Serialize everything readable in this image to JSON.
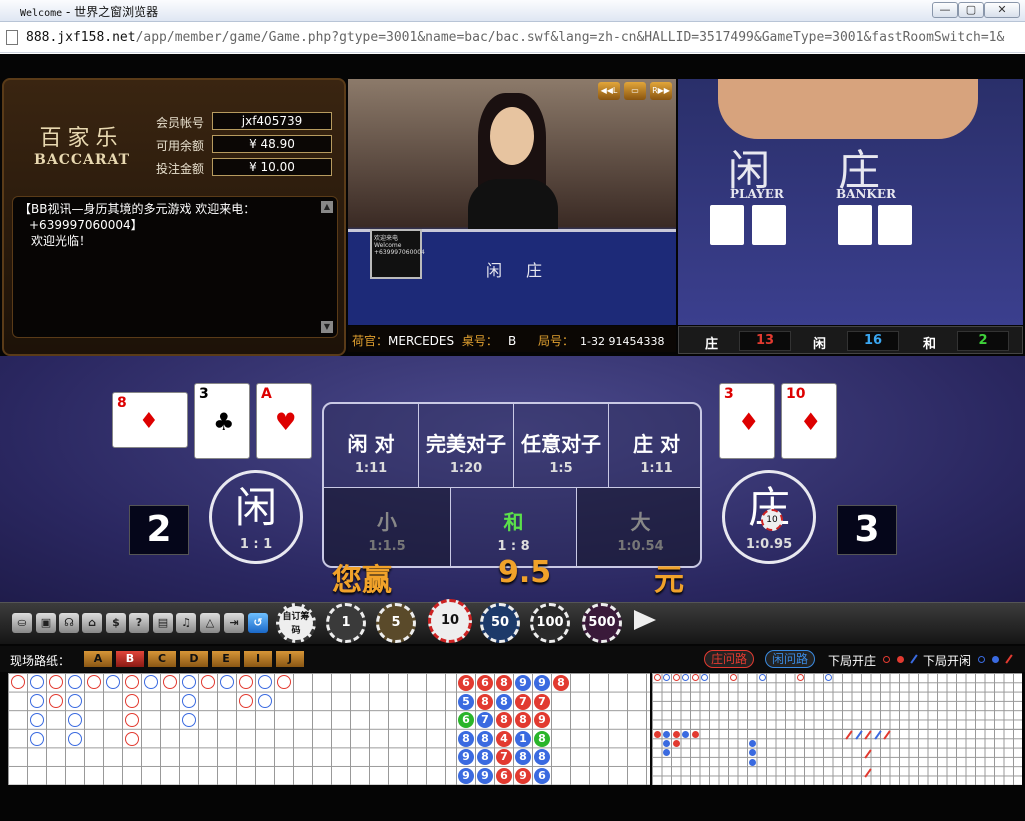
{
  "window": {
    "title_prefix": "Welcome",
    "title_rest": " - 世界之窗浏览器"
  },
  "address": {
    "host": "888.jxf158.net",
    "path": "/app/member/game/Game.php?gtype=3001&name=bac/bac.swf&lang=zh-cn&HALLID=3517499&GameType=3001&fastRoomSwitch=1&"
  },
  "logo": {
    "cn": "百家乐",
    "en": "BACCARAT"
  },
  "account": {
    "member_label": "会员帐号",
    "member_value": "jxf405739",
    "balance_label": "可用余额",
    "balance_value": "¥ 48.90",
    "bet_label": "投注金额",
    "bet_value": "¥ 10.00"
  },
  "notice": {
    "line1": "【BB视讯—身历其境的多元游戏  欢迎来电：",
    "line2": "+639997060004】",
    "line3": "欢迎光临！"
  },
  "video1": {
    "screen_text": "欢迎来电 Welcome +639997060004",
    "table_player": "闲",
    "table_banker": "庄"
  },
  "video2": {
    "player_cn": "闲",
    "player_en": "PLAYER",
    "banker_cn": "庄",
    "banker_en": "BANKER"
  },
  "video_controls": [
    "◀◀L",
    "▭",
    "R▶▶"
  ],
  "table_info": {
    "dealer_label": "荷官：",
    "dealer_value": "MERCEDES",
    "table_label": "桌号：",
    "table_value": "B",
    "round_label": "局号：",
    "round_value": "1-32 91454338"
  },
  "stats": {
    "banker_label": "庄",
    "banker_value": "13",
    "player_label": "闲",
    "player_value": "16",
    "tie_label": "和",
    "tie_value": "2",
    "colors": {
      "banker": "#e23a30",
      "player": "#3aa6f0",
      "tie": "#3fd23a"
    }
  },
  "player_cards": [
    {
      "rank": "8",
      "suit": "♦",
      "color": "#d00"
    },
    {
      "rank": "3",
      "suit": "♣",
      "color": "#000"
    },
    {
      "rank": "A",
      "suit": "♥",
      "color": "#d00"
    }
  ],
  "banker_cards": [
    {
      "rank": "3",
      "suit": "♦",
      "color": "#d00"
    },
    {
      "rank": "10",
      "suit": "♦",
      "color": "#d00"
    }
  ],
  "bets": {
    "top": [
      {
        "name": "闲 对",
        "odds": "1:11"
      },
      {
        "name": "完美对子",
        "odds": "1:20"
      },
      {
        "name": "任意对子",
        "odds": "1:5"
      },
      {
        "name": "庄 对",
        "odds": "1:11"
      }
    ],
    "bottom": [
      {
        "name": "小",
        "odds": "1:1.5"
      },
      {
        "name": "和",
        "odds": "1 : 8"
      },
      {
        "name": "大",
        "odds": "1:0.54"
      }
    ],
    "player": {
      "name": "闲",
      "odds": "1 : 1"
    },
    "banker": {
      "name": "庄",
      "odds": "1:0.95",
      "chip": "10"
    }
  },
  "points": {
    "player": "2",
    "banker": "3"
  },
  "result": {
    "prefix": "您赢",
    "amount": "9.5",
    "suffix": "元"
  },
  "toolbar_icons": [
    "⛀",
    "▣",
    "☊",
    "⌂",
    "$",
    "?",
    "▤",
    "♫",
    "△",
    "⇥",
    "↺"
  ],
  "chips": [
    {
      "label": "自订筹码",
      "color": "#222"
    },
    {
      "label": "1",
      "color": "#3a3a3a"
    },
    {
      "label": "5",
      "color": "#5a4a2a"
    },
    {
      "label": "10",
      "color": "#eee"
    },
    {
      "label": "50",
      "color": "#1d3a6a"
    },
    {
      "label": "100",
      "color": "#2a2a2a"
    },
    {
      "label": "500",
      "color": "#3a1a3a"
    }
  ],
  "road": {
    "title": "现场路纸：",
    "tabs": [
      "A",
      "B",
      "C",
      "D",
      "E",
      "I",
      "J"
    ],
    "active_tab": "B",
    "banker_road_btn": "庄问路",
    "player_road_btn": "闲问路",
    "next_banker": "下局开庄",
    "next_player": "下局开闲"
  },
  "bead_numbers": [
    [
      [
        "6",
        "#e23a30"
      ],
      [
        "6",
        "#e23a30"
      ],
      [
        "8",
        "#e23a30"
      ],
      [
        "9",
        "#3a6ae0"
      ],
      [
        "9",
        "#3a6ae0"
      ],
      [
        "8",
        "#e23a30"
      ]
    ],
    [
      [
        "5",
        "#3a6ae0"
      ],
      [
        "8",
        "#e23a30"
      ],
      [
        "8",
        "#3a6ae0"
      ],
      [
        "7",
        "#e23a30"
      ],
      [
        "7",
        "#e23a30"
      ]
    ],
    [
      [
        "6",
        "#2ab52a"
      ],
      [
        "7",
        "#3a6ae0"
      ],
      [
        "8",
        "#e23a30"
      ],
      [
        "8",
        "#e23a30"
      ],
      [
        "9",
        "#e23a30"
      ]
    ],
    [
      [
        "8",
        "#3a6ae0"
      ],
      [
        "8",
        "#3a6ae0"
      ],
      [
        "4",
        "#e23a30"
      ],
      [
        "1",
        "#3a6ae0"
      ],
      [
        "8",
        "#2ab52a"
      ]
    ],
    [
      [
        "9",
        "#3a6ae0"
      ],
      [
        "8",
        "#3a6ae0"
      ],
      [
        "7",
        "#e23a30"
      ],
      [
        "8",
        "#3a6ae0"
      ],
      [
        "8",
        "#3a6ae0"
      ]
    ],
    [
      [
        "9",
        "#3a6ae0"
      ],
      [
        "9",
        "#3a6ae0"
      ],
      [
        "6",
        "#e23a30"
      ],
      [
        "9",
        "#e23a30"
      ],
      [
        "6",
        "#3a6ae0"
      ]
    ]
  ]
}
